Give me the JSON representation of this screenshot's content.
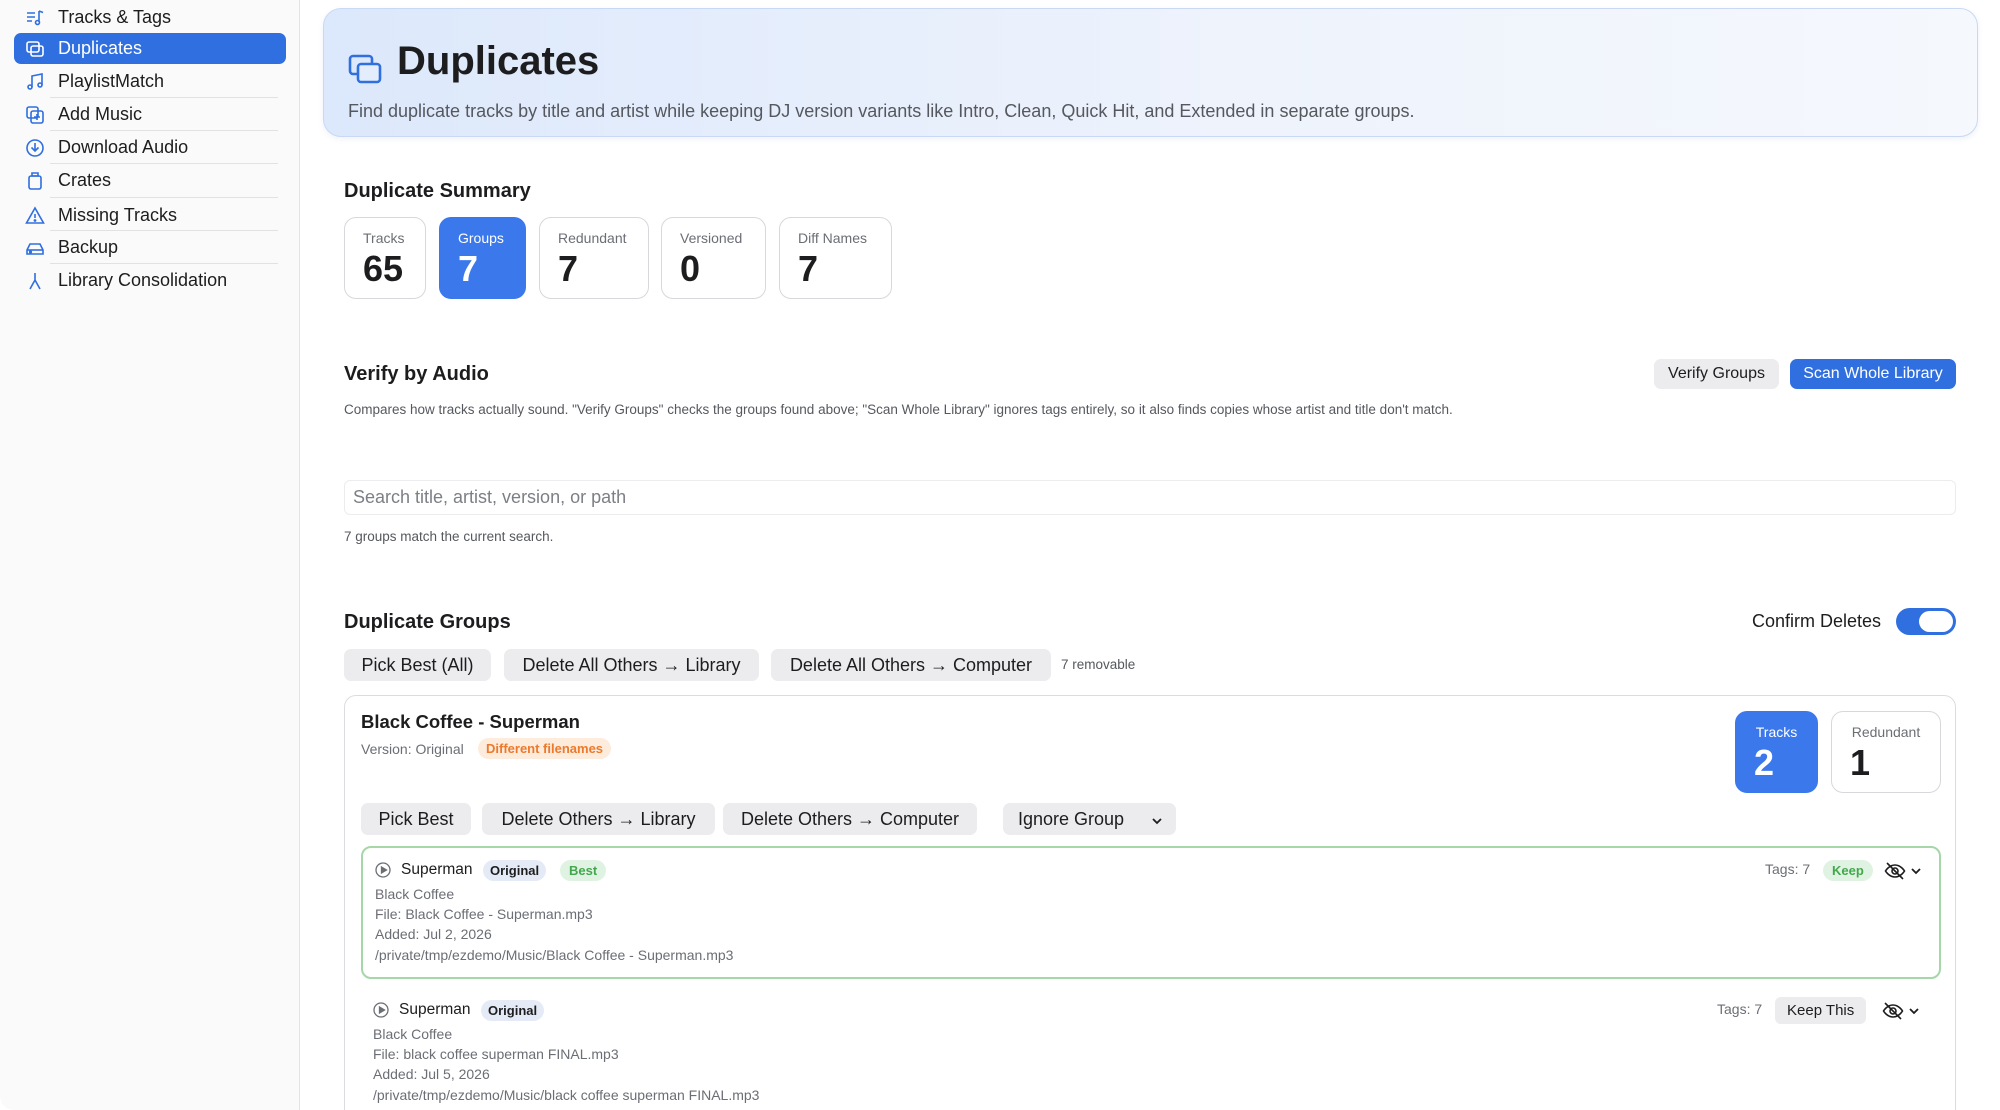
{
  "sidebar": {
    "items": [
      {
        "label": "Tracks & Tags",
        "icon": "music-list-icon"
      },
      {
        "label": "Duplicates",
        "icon": "duplicate-icon",
        "active": true
      },
      {
        "label": "PlaylistMatch",
        "icon": "music-notes-icon"
      },
      {
        "label": "Add Music",
        "icon": "add-square-icon"
      },
      {
        "label": "Download Audio",
        "icon": "download-circle-icon"
      },
      {
        "label": "Crates",
        "icon": "crate-icon"
      },
      {
        "label": "Missing Tracks",
        "icon": "warning-icon"
      },
      {
        "label": "Backup",
        "icon": "drive-icon"
      },
      {
        "label": "Library Consolidation",
        "icon": "merge-icon"
      }
    ]
  },
  "header": {
    "title": "Duplicates",
    "subtitle": "Find duplicate tracks by title and artist while keeping DJ version variants like Intro, Clean, Quick Hit, and Extended in separate groups."
  },
  "summary": {
    "title": "Duplicate Summary",
    "stats": [
      {
        "label": "Tracks",
        "value": "65"
      },
      {
        "label": "Groups",
        "value": "7",
        "active": true
      },
      {
        "label": "Redundant",
        "value": "7"
      },
      {
        "label": "Versioned",
        "value": "0"
      },
      {
        "label": "Diff Names",
        "value": "7"
      }
    ]
  },
  "verify": {
    "title": "Verify by Audio",
    "verify_groups_label": "Verify Groups",
    "scan_label": "Scan Whole Library",
    "description": "Compares how tracks actually sound. \"Verify Groups\" checks the groups found above; \"Scan Whole Library\" ignores tags entirely, so it also finds copies whose artist and title don't match."
  },
  "search": {
    "placeholder": "Search title, artist, version, or path",
    "value": "",
    "match_text": "7 groups match the current search."
  },
  "groups_section": {
    "title": "Duplicate Groups",
    "confirm_label": "Confirm Deletes",
    "confirm_on": true,
    "pick_best_all": "Pick Best (All)",
    "delete_all_library": "Delete All Others → Library",
    "delete_all_computer": "Delete All Others → Computer",
    "removable": "7 removable"
  },
  "group": {
    "title": "Black Coffee - Superman",
    "version": "Version: Original",
    "diff_badge": "Different filenames",
    "stats": [
      {
        "label": "Tracks",
        "value": "2",
        "active": true
      },
      {
        "label": "Redundant",
        "value": "1"
      }
    ],
    "pick_best": "Pick Best",
    "delete_library": "Delete Others → Library",
    "delete_computer": "Delete Others → Computer",
    "ignore": "Ignore Group",
    "tracks": [
      {
        "title": "Superman",
        "version": "Original",
        "best": "Best",
        "artist": "Black Coffee",
        "file": "File: Black Coffee - Superman.mp3",
        "added": "Added: Jul 2, 2026",
        "path": "/private/tmp/ezdemo/Music/Black Coffee - Superman.mp3",
        "tags": "Tags: 7",
        "action": "Keep"
      },
      {
        "title": "Superman",
        "version": "Original",
        "artist": "Black Coffee",
        "file": "File: black coffee superman FINAL.mp3",
        "added": "Added: Jul 5, 2026",
        "path": "/private/tmp/ezdemo/Music/black coffee superman FINAL.mp3",
        "tags": "Tags: 7",
        "action": "Keep This"
      }
    ]
  },
  "colors": {
    "accent": "#2f6fe0",
    "stat_active": "#3a78ec",
    "best_border": "#a5d7a8",
    "keep_green": "#43a84d",
    "diff_orange": "#ec7a2c"
  }
}
